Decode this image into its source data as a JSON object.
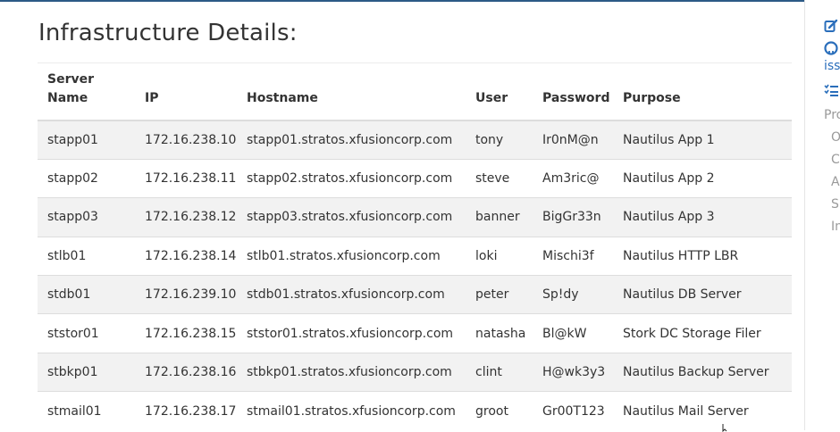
{
  "page": {
    "title": "Infrastructure Details:"
  },
  "table": {
    "headers": {
      "server_name": "Server Name",
      "ip": "IP",
      "hostname": "Hostname",
      "user": "User",
      "password": "Password",
      "purpose": "Purpose"
    },
    "rows": [
      {
        "server": "stapp01",
        "ip": "172.16.238.10",
        "hostname": "stapp01.stratos.xfusioncorp.com",
        "user": "tony",
        "password": "Ir0nM@n",
        "purpose": "Nautilus App 1"
      },
      {
        "server": "stapp02",
        "ip": "172.16.238.11",
        "hostname": "stapp02.stratos.xfusioncorp.com",
        "user": "steve",
        "password": "Am3ric@",
        "purpose": "Nautilus App 2"
      },
      {
        "server": "stapp03",
        "ip": "172.16.238.12",
        "hostname": "stapp03.stratos.xfusioncorp.com",
        "user": "banner",
        "password": "BigGr33n",
        "purpose": "Nautilus App 3"
      },
      {
        "server": "stlb01",
        "ip": "172.16.238.14",
        "hostname": "stlb01.stratos.xfusioncorp.com",
        "user": "loki",
        "password": "Mischi3f",
        "purpose": "Nautilus HTTP LBR"
      },
      {
        "server": "stdb01",
        "ip": "172.16.239.10",
        "hostname": "stdb01.stratos.xfusioncorp.com",
        "user": "peter",
        "password": "Sp!dy",
        "purpose": "Nautilus DB Server"
      },
      {
        "server": "ststor01",
        "ip": "172.16.238.15",
        "hostname": "ststor01.stratos.xfusioncorp.com",
        "user": "natasha",
        "password": "Bl@kW",
        "purpose": "Stork DC Storage Filer"
      },
      {
        "server": "stbkp01",
        "ip": "172.16.238.16",
        "hostname": "stbkp01.stratos.xfusioncorp.com",
        "user": "clint",
        "password": "H@wk3y3",
        "purpose": "Nautilus Backup Server"
      },
      {
        "server": "stmail01",
        "ip": "172.16.238.17",
        "hostname": "stmail01.stratos.xfusioncorp.com",
        "user": "groot",
        "password": "Gr00T123",
        "purpose": "Nautilus Mail Server"
      }
    ]
  },
  "sidebar": {
    "link_text": "issu",
    "items": [
      "Pro",
      "O",
      "Cr",
      "Ap",
      "Sh",
      "In"
    ],
    "icons": [
      "edit-icon",
      "github-icon",
      "task-list-icon"
    ],
    "accent_color": "#2a6ebb"
  }
}
